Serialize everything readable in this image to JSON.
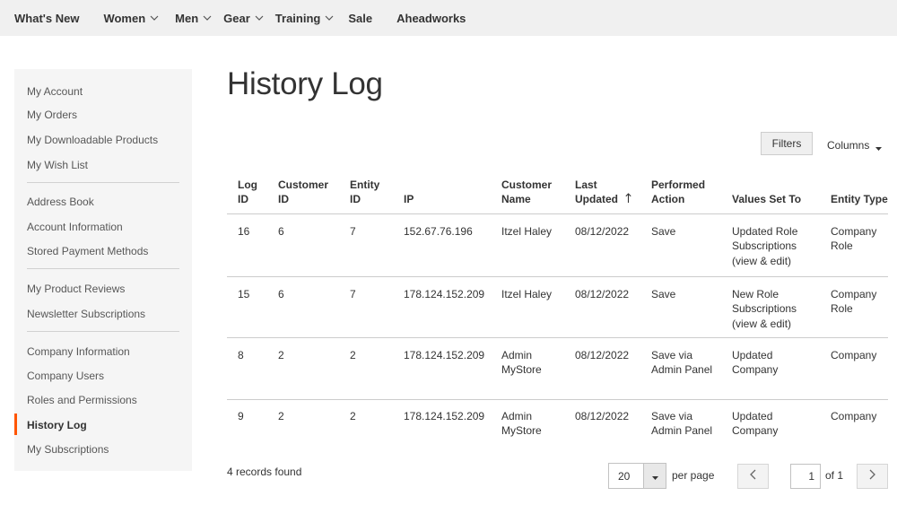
{
  "nav": {
    "items": [
      {
        "label": "What's New",
        "has_dropdown": false
      },
      {
        "label": "Women",
        "has_dropdown": true
      },
      {
        "label": "Men",
        "has_dropdown": true
      },
      {
        "label": "Gear",
        "has_dropdown": true
      },
      {
        "label": "Training",
        "has_dropdown": true
      },
      {
        "label": "Sale",
        "has_dropdown": false
      },
      {
        "label": "Aheadworks",
        "has_dropdown": false
      }
    ]
  },
  "sidebar": {
    "items": [
      {
        "label": "My Account"
      },
      {
        "label": "My Orders"
      },
      {
        "label": "My Downloadable Products"
      },
      {
        "label": "My Wish List"
      },
      {
        "label": "Address Book"
      },
      {
        "label": "Account Information"
      },
      {
        "label": "Stored Payment Methods"
      },
      {
        "label": "My Product Reviews"
      },
      {
        "label": "Newsletter Subscriptions"
      },
      {
        "label": "Company Information"
      },
      {
        "label": "Company Users"
      },
      {
        "label": "Roles and Permissions"
      },
      {
        "label": "History Log"
      },
      {
        "label": "My Subscriptions"
      }
    ],
    "active_label": "History Log",
    "accent_color": "#ff5501"
  },
  "main": {
    "title": "History Log",
    "filters_label": "Filters",
    "columns_label": "Columns"
  },
  "table": {
    "headers": {
      "log_id": "Log ID",
      "customer_id": "Customer ID",
      "entity_id": "Entity ID",
      "ip": "IP",
      "customer_name": "Customer Name",
      "last_updated": "Last Updated",
      "performed_action": "Performed Action",
      "values_set_to": "Values Set To",
      "entity_type": "Entity Type"
    },
    "sorted_column": "last_updated",
    "sort_direction": "ascending",
    "rows": [
      {
        "log_id": "16",
        "customer_id": "6",
        "entity_id": "7",
        "ip": "152.67.76.196",
        "customer_name": "Itzel Haley",
        "last_updated": "08/12/2022",
        "performed_action": "Save",
        "values_set_to": "Updated Role Subscriptions (view & edit)",
        "entity_type": "Company Role"
      },
      {
        "log_id": "15",
        "customer_id": "6",
        "entity_id": "7",
        "ip": "178.124.152.209",
        "customer_name": "Itzel Haley",
        "last_updated": "08/12/2022",
        "performed_action": "Save",
        "values_set_to": "New Role Subscriptions (view & edit)",
        "entity_type": "Company Role"
      },
      {
        "log_id": "8",
        "customer_id": "2",
        "entity_id": "2",
        "ip": "178.124.152.209",
        "customer_name": "Admin MyStore",
        "last_updated": "08/12/2022",
        "performed_action": "Save via Admin Panel",
        "values_set_to": "Updated Company",
        "entity_type": "Company"
      },
      {
        "log_id": "9",
        "customer_id": "2",
        "entity_id": "2",
        "ip": "178.124.152.209",
        "customer_name": "Admin MyStore",
        "last_updated": "08/12/2022",
        "performed_action": "Save via Admin Panel",
        "values_set_to": "Updated Company",
        "entity_type": "Company"
      }
    ]
  },
  "footer": {
    "records_text": "4 records found",
    "per_page_value": "20",
    "per_page_label": "per page",
    "current_page": "1",
    "of_pages_text": "of 1"
  }
}
